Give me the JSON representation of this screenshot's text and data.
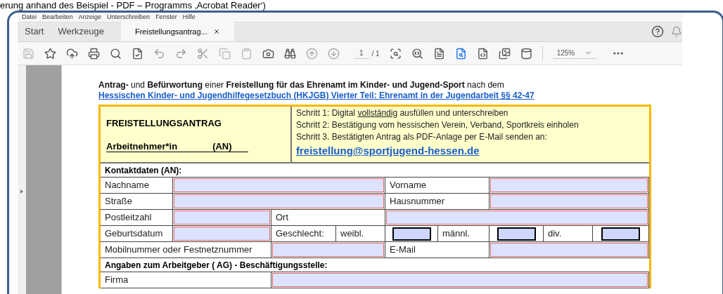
{
  "caption": "erung anhand des Beispiel - PDF – Programms ‚Acrobat Reader‘)",
  "menu": [
    "Datei",
    "Bearbeiten",
    "Anzeige",
    "Unterschreiben",
    "Fenster",
    "Hilfe"
  ],
  "tabs": [
    {
      "label": "Start",
      "selected": false,
      "closable": false
    },
    {
      "label": "Werkzeuge",
      "selected": false,
      "closable": false
    },
    {
      "label": "Freistellungsantrag...",
      "selected": true,
      "closable": true
    }
  ],
  "toolbar": {
    "page": "1",
    "page_total": "/ 1",
    "zoom": "125%"
  },
  "document": {
    "intro": "**Antrag-** und **Befürwortung** einer **Freistellung für das Ehrenamt im Kinder- und Jugend-Sport** nach dem",
    "intro_link": "Hessischen Kinder- und Jugendhilfegesetzbuch (HKJGB) Vierter Teil: Ehrenamt in der Jugendarbeit §§ 42-47",
    "title": "FREISTELLUNGSANTRAG",
    "subtitle": [
      "Arbeitnehmer*in",
      "(AN)"
    ],
    "steps": [
      {
        "text": "Schritt 1: Digital",
        "underlined": "vollständig",
        "after": "ausfüllen und unterschreiben"
      },
      {
        "text": "Schritt 2: Bestätigung vom hessischen Verein, Verband, Sportkreis einholen"
      },
      {
        "text": "Schritt 3. Bestätigten Antrag als PDF-Anlage per E-Mail senden an:"
      }
    ],
    "email": "freistellung@sportjugend-hessen.de",
    "sections": [
      {
        "heading": "Kontaktdaten (AN):",
        "rows": [
          [
            {
              "kind": "label",
              "text": "Nachname"
            },
            {
              "kind": "field"
            },
            {
              "kind": "label",
              "text": "Vorname"
            },
            {
              "kind": "field"
            }
          ],
          [
            {
              "kind": "label",
              "text": "Straße"
            },
            {
              "kind": "field"
            },
            {
              "kind": "label",
              "text": "Hausnummer"
            },
            {
              "kind": "field"
            }
          ],
          [
            {
              "kind": "label",
              "text": "Postleitzahl"
            },
            {
              "kind": "field"
            },
            {
              "kind": "label",
              "text": "Ort"
            },
            {
              "kind": "field"
            }
          ],
          [
            {
              "kind": "label",
              "text": "Geburtsdatum"
            },
            {
              "kind": "field"
            },
            {
              "kind": "label",
              "text": "Geschlecht:"
            },
            {
              "kind": "label",
              "text": "weibl."
            },
            {
              "kind": "checkbox",
              "checked": false
            },
            {
              "kind": "label",
              "text": "männl."
            },
            {
              "kind": "checkbox",
              "checked": false
            },
            {
              "kind": "label",
              "text": "div."
            },
            {
              "kind": "checkbox",
              "checked": false
            }
          ],
          [
            {
              "kind": "label",
              "text": "Mobilnummer oder Festnetznummer"
            },
            {
              "kind": "field"
            },
            {
              "kind": "label",
              "text": "E-Mail"
            },
            {
              "kind": "field"
            }
          ]
        ]
      },
      {
        "heading": "Angaben zum Arbeitgeber ( AG) - Beschäftigungsstelle:",
        "rows": [
          [
            {
              "kind": "label",
              "text": "Firma"
            },
            {
              "kind": "field"
            }
          ]
        ]
      }
    ]
  }
}
